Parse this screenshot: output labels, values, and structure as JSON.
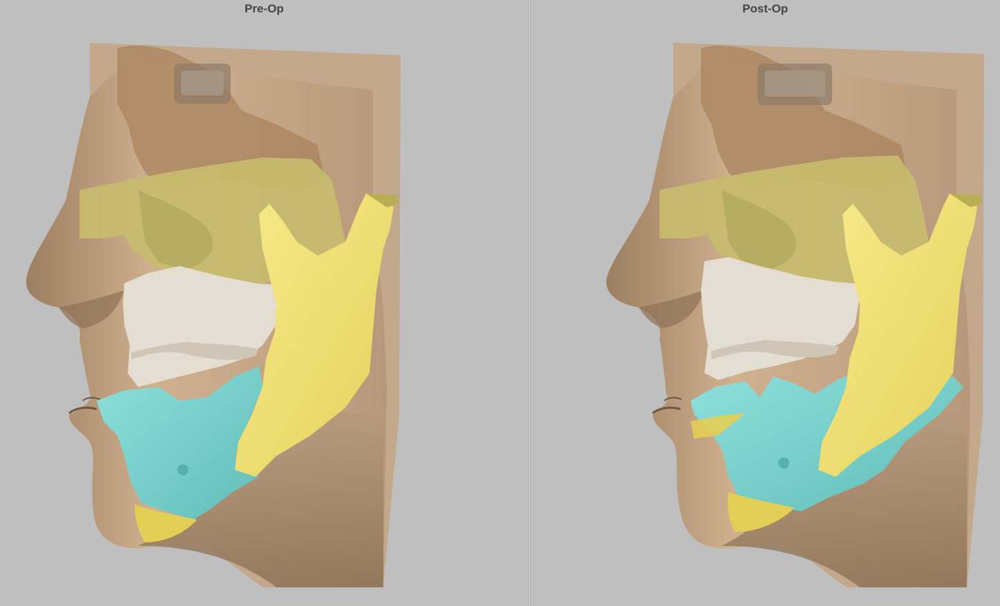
{
  "viewports": {
    "left": {
      "title": "Pre-Op"
    },
    "right": {
      "title": "Post-Op"
    }
  },
  "colors": {
    "background": "#bfbfbf",
    "skin": "#c9ab8b",
    "skin_shadow": "#8f7357",
    "bone_upper": "#b08b65",
    "maxilla": "#c8bd72",
    "teeth": "#e4ddd3",
    "mandible_body": "#7fd6d2",
    "ramus": "#f2e070",
    "chin_segment": "#e3cf55"
  }
}
